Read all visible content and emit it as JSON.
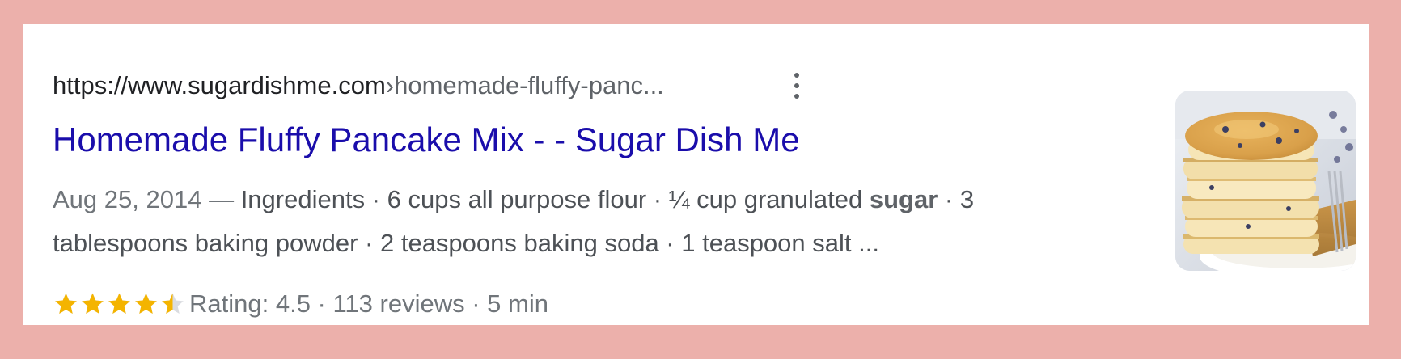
{
  "result": {
    "url": {
      "domain": "https://www.sugardishme.com",
      "separator": " › ",
      "path": "homemade-fluffy-panc..."
    },
    "menu_icon": "more-vert-icon",
    "title": "Homemade Fluffy Pancake Mix - - Sugar Dish Me",
    "snippet": {
      "date": "Aug 25, 2014",
      "dash": " — ",
      "line1_text": "Ingredients · 6 cups all purpose flour · ¼ cup granulated ",
      "line1_bold": "sugar",
      "line1_tail": " · 3",
      "line2_text": "tablespoons baking powder · 2 teaspoons baking soda · 1 teaspoon salt ..."
    },
    "rating": {
      "stars": 4.5,
      "max_stars": 5,
      "text": "Rating: 4.5 · 113 reviews · 5 min"
    },
    "thumbnail": {
      "icon": "pancake-stack-image",
      "alt": "Stack of fluffy pancakes with blueberries and syrup"
    }
  },
  "colors": {
    "page_background": "#ecb0ab",
    "card_background": "#ffffff",
    "title_link": "#1a0dab",
    "url_text": "#202124",
    "secondary_text": "#4d5156",
    "star_filled": "#f4b400",
    "star_empty": "#dadce0"
  }
}
